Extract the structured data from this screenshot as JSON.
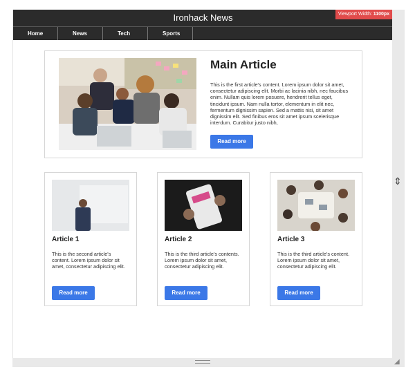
{
  "header": {
    "title": "Ironhack News"
  },
  "viewport_badge": {
    "label": "Viewport Width:",
    "value": "1100px"
  },
  "nav": {
    "items": [
      "Home",
      "News",
      "Tech",
      "Sports"
    ]
  },
  "main_article": {
    "title": "Main Article",
    "text": "This is the first article's content. Lorem ipsum dolor sit amet, consectetur adipiscing elit. Morbi ac lacinia nibh, nec faucibus enim. Nullam quis lorem posuere, hendrerit tellus eget, tincidunt ipsum. Nam nulla tortor, elementum in elit nec, fermentum dignissim sapien. Sed a mattis nisi, sit amet dignissim elit. Sed finibus eros sit amet ipsum scelerisque interdum. Curabitur justo nibh,",
    "button": "Read more"
  },
  "articles": [
    {
      "title": "Article 1",
      "text": "This is the second article's content. Lorem ipsum dolor sit amet, consectetur adipiscing elit.",
      "button": "Read more"
    },
    {
      "title": "Article 2",
      "text": "This is the third article's contents. Lorem ipsum dolor sit amet, consectetur adipiscing elit.",
      "button": "Read more"
    },
    {
      "title": "Article 3",
      "text": "This is the third article's content. Lorem ipsum dolor sit amet, consectetur adipiscing elit.",
      "button": "Read more"
    }
  ],
  "colors": {
    "header_bg": "#2b2b2b",
    "button_bg": "#3b78e7",
    "badge_bg": "#e14b4b"
  },
  "icons": [
    "resize-handle-icon",
    "drag-grip-icon",
    "corner-resize-icon"
  ]
}
